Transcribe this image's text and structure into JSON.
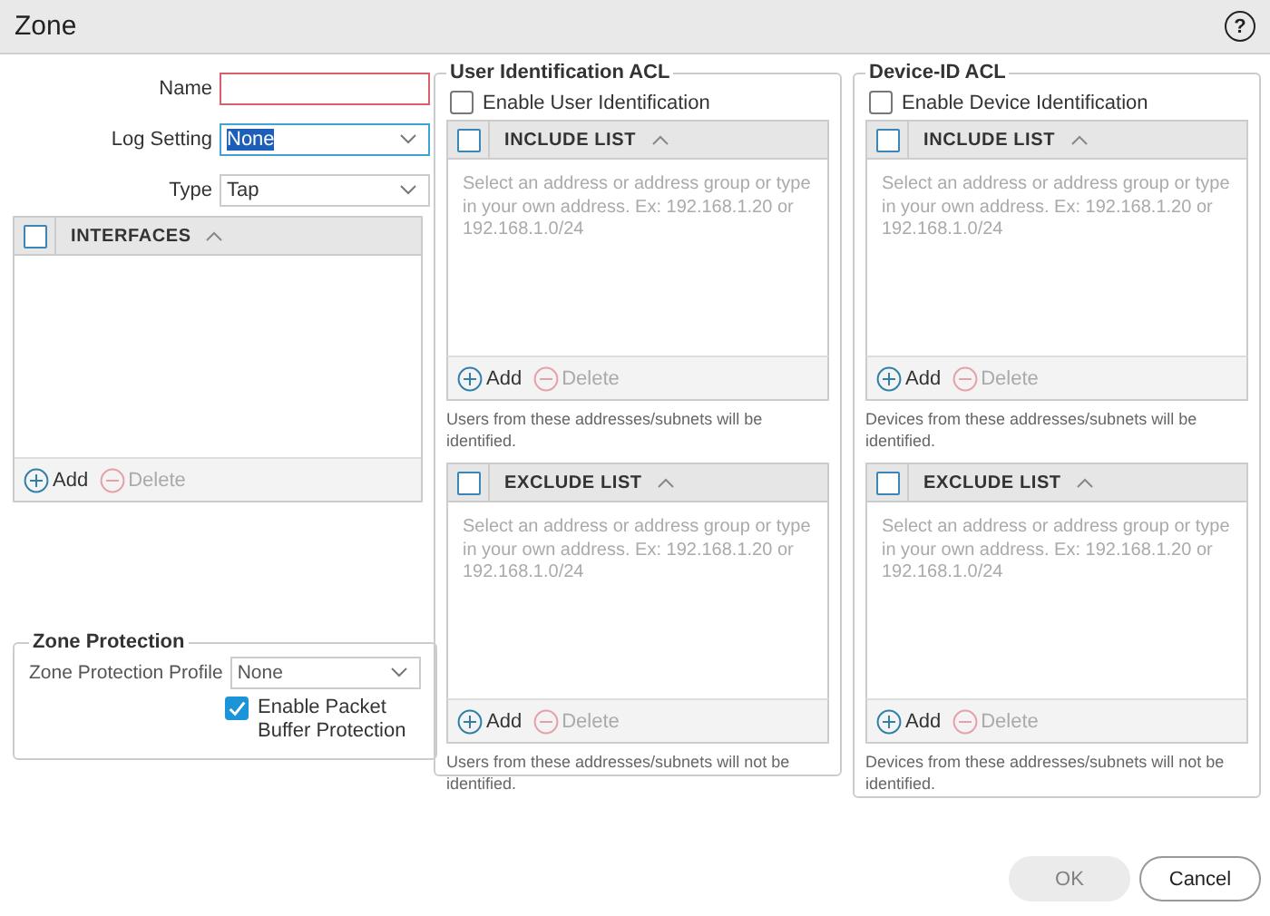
{
  "window": {
    "title": "Zone",
    "help": "?"
  },
  "fields": [
    {
      "label": "Name",
      "kind": "text",
      "invalid": true
    },
    {
      "label": "Log Setting",
      "kind": "select",
      "value": "None",
      "text_selected": true
    },
    {
      "label": "Type",
      "kind": "select",
      "value": "Tap",
      "text_selected": false
    }
  ],
  "interfaces": {
    "header": "INTERFACES",
    "checked": false,
    "actions": [
      {
        "label": "Add",
        "disabled": false
      },
      {
        "label": "Delete",
        "disabled": true
      }
    ]
  },
  "zone_protection": {
    "legend": "Zone Protection",
    "profile_label": "Zone Protection Profile",
    "profile_value": "None",
    "packet_buffer": {
      "label": "Enable Packet Buffer Protection",
      "checked": true
    }
  },
  "acls": [
    {
      "legend": "User Identification ACL",
      "enable": {
        "label": "Enable User Identification",
        "checked": false
      },
      "lists": [
        {
          "header": "INCLUDE LIST",
          "checked": false,
          "placeholder": "Select an address or address group or type in your own address. Ex: 192.168.1.20 or 192.168.1.0/24",
          "actions": [
            {
              "label": "Add",
              "disabled": false
            },
            {
              "label": "Delete",
              "disabled": true
            }
          ],
          "note": "Users from these addresses/subnets will be identified."
        },
        {
          "header": "EXCLUDE LIST",
          "checked": false,
          "placeholder": "Select an address or address group or type in your own address. Ex: 192.168.1.20 or 192.168.1.0/24",
          "actions": [
            {
              "label": "Add",
              "disabled": false
            },
            {
              "label": "Delete",
              "disabled": true
            }
          ],
          "note": "Users from these addresses/subnets will not be identified."
        }
      ]
    },
    {
      "legend": "Device-ID ACL",
      "enable": {
        "label": "Enable Device Identification",
        "checked": false
      },
      "lists": [
        {
          "header": "INCLUDE LIST",
          "checked": false,
          "placeholder": "Select an address or address group or type in your own address. Ex: 192.168.1.20 or 192.168.1.0/24",
          "actions": [
            {
              "label": "Add",
              "disabled": false
            },
            {
              "label": "Delete",
              "disabled": true
            }
          ],
          "note": "Devices from these addresses/subnets will be identified."
        },
        {
          "header": "EXCLUDE LIST",
          "checked": false,
          "placeholder": "Select an address or address group or type in your own address. Ex: 192.168.1.20 or 192.168.1.0/24",
          "actions": [
            {
              "label": "Add",
              "disabled": false
            },
            {
              "label": "Delete",
              "disabled": true
            }
          ],
          "note": "Devices from these addresses/subnets will not be identified."
        }
      ]
    }
  ],
  "buttons": [
    {
      "label": "OK",
      "disabled": true
    },
    {
      "label": "Cancel",
      "disabled": false
    }
  ]
}
